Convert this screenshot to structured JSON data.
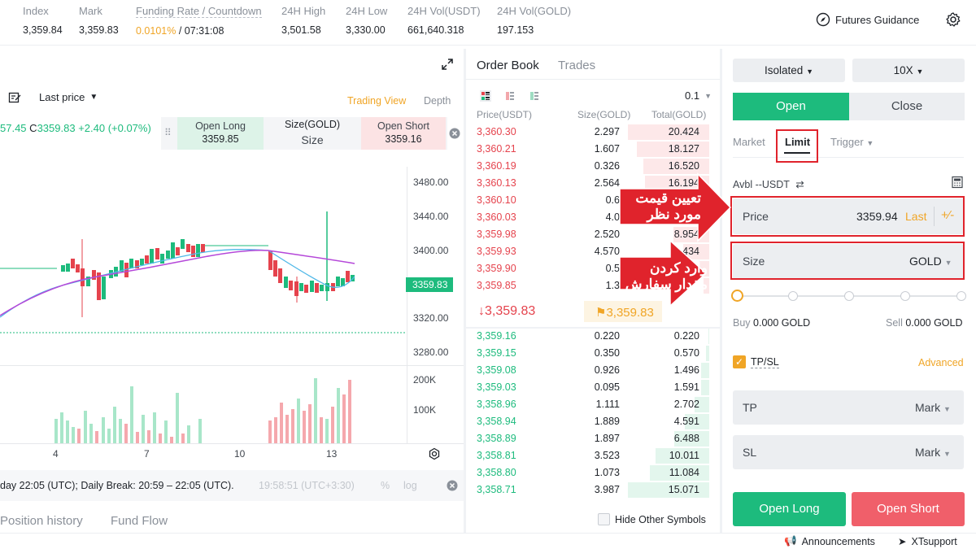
{
  "top_stats": [
    {
      "label": "Index",
      "value": "3,359.84",
      "color": "#1f2329"
    },
    {
      "label": "Mark",
      "value": "3,359.83",
      "color": "#1f2329"
    },
    {
      "label": "Funding Rate / Countdown",
      "value_rate": "0.0101%",
      "value_sep": " / ",
      "value_countdown": "07:31:08"
    },
    {
      "label": "24H High",
      "value": "3,501.58"
    },
    {
      "label": "24H Low",
      "value": "3,330.00"
    },
    {
      "label": "24H Vol(USDT)",
      "value": "661,640.318"
    },
    {
      "label": "24H Vol(GOLD)",
      "value": "197.153"
    }
  ],
  "header_right": {
    "guidance": "Futures Guidance"
  },
  "chart": {
    "toolbar": {
      "price_type": "Last price",
      "trading_view": "Trading View",
      "depth": "Depth"
    },
    "ohlc": {
      "o_partial": "57.45",
      "c_label": "C",
      "c_value": "3359.83",
      "change": "+2.40 (+0.07%)"
    },
    "open_long": {
      "label": "Open Long",
      "price": "3359.85"
    },
    "size_box": {
      "label": "Size(GOLD)",
      "value": "Size"
    },
    "open_short": {
      "label": "Open Short",
      "price": "3359.16"
    },
    "price_axis": [
      "3480.00",
      "3440.00",
      "3400.00",
      "3320.00",
      "3280.00"
    ],
    "current_price_tag": "3359.83",
    "volume_axis": [
      "200K",
      "100K"
    ],
    "date_axis": [
      "4",
      "7",
      "10",
      "13"
    ],
    "footer_text": "day 22:05 (UTC); Daily Break: 20:59 – 22:05 (UTC).",
    "footer_time": "19:58:51 (UTC+3:30)",
    "footer_pct": "%",
    "footer_log": "log"
  },
  "bottom_tabs": [
    "Position history",
    "Fund Flow"
  ],
  "hide_other_symbols": "Hide Other Symbols",
  "orderbook": {
    "tabs": [
      "Order Book",
      "Trades"
    ],
    "precision": "0.1",
    "headers": [
      "Price(USDT)",
      "Size(GOLD)",
      "Total(GOLD)"
    ],
    "asks": [
      {
        "price": "3,360.30",
        "size": "2.297",
        "total": "20.424",
        "depth": 1.0
      },
      {
        "price": "3,360.21",
        "size": "1.607",
        "total": "18.127",
        "depth": 0.89
      },
      {
        "price": "3,360.19",
        "size": "0.326",
        "total": "16.520",
        "depth": 0.81
      },
      {
        "price": "3,360.13",
        "size": "2.564",
        "total": "16.194",
        "depth": 0.79
      },
      {
        "price": "3,360.10",
        "size": "0.6",
        "total": "",
        "depth": 0.67
      },
      {
        "price": "3,360.03",
        "size": "4.0",
        "total": "",
        "depth": 0.64
      },
      {
        "price": "3,359.98",
        "size": "2.520",
        "total": "8.954",
        "depth": 0.44
      },
      {
        "price": "3,359.93",
        "size": "4.570",
        "total": "6.434",
        "depth": 0.32
      },
      {
        "price": "3,359.90",
        "size": "0.5",
        "total": "",
        "depth": 0.12
      },
      {
        "price": "3,359.85",
        "size": "1.3",
        "total": "",
        "depth": 0.07
      }
    ],
    "last_price": "3,359.83",
    "mark_price": "3,359.83",
    "bids": [
      {
        "price": "3,359.16",
        "size": "0.220",
        "total": "0.220",
        "depth": 0.01
      },
      {
        "price": "3,359.15",
        "size": "0.350",
        "total": "0.570",
        "depth": 0.04
      },
      {
        "price": "3,359.08",
        "size": "0.926",
        "total": "1.496",
        "depth": 0.1
      },
      {
        "price": "3,359.03",
        "size": "0.095",
        "total": "1.591",
        "depth": 0.1
      },
      {
        "price": "3,358.96",
        "size": "1.111",
        "total": "2.702",
        "depth": 0.18
      },
      {
        "price": "3,358.94",
        "size": "1.889",
        "total": "4.591",
        "depth": 0.3
      },
      {
        "price": "3,358.89",
        "size": "1.897",
        "total": "6.488",
        "depth": 0.43
      },
      {
        "price": "3,358.81",
        "size": "3.523",
        "total": "10.011",
        "depth": 0.66
      },
      {
        "price": "3,358.80",
        "size": "1.073",
        "total": "11.084",
        "depth": 0.73
      },
      {
        "price": "3,358.71",
        "size": "3.987",
        "total": "15.071",
        "depth": 1.0
      }
    ]
  },
  "trade": {
    "margin_mode": "Isolated",
    "leverage": "10X",
    "open": "Open",
    "close": "Close",
    "order_tabs": [
      "Market",
      "Limit",
      "Trigger"
    ],
    "avbl_label": "Avbl",
    "avbl_value": "--USDT",
    "price_label": "Price",
    "price_value": "3359.94",
    "price_last": "Last",
    "size_label": "Size",
    "size_unit": "GOLD",
    "buy_label": "Buy",
    "buy_value": "0.000 GOLD",
    "sell_label": "Sell",
    "sell_value": "0.000 GOLD",
    "tpsl": "TP/SL",
    "advanced": "Advanced",
    "tp_label": "TP",
    "tp_value": "Mark",
    "sl_label": "SL",
    "sl_value": "Mark",
    "open_long": "Open Long",
    "open_short": "Open Short"
  },
  "annotations": {
    "price_note_line1": "تعیین قیمت",
    "price_note_line2": "مورد نظر",
    "size_note_line1": "وارد کردن",
    "size_note_line2": "مقدار سفارش"
  },
  "footer": {
    "announcements": "Announcements",
    "support": "XTsupport"
  },
  "colors": {
    "green": "#1dbb7d",
    "red": "#e5434d",
    "orange": "#f0a526",
    "annotation_red": "#e0232c"
  }
}
